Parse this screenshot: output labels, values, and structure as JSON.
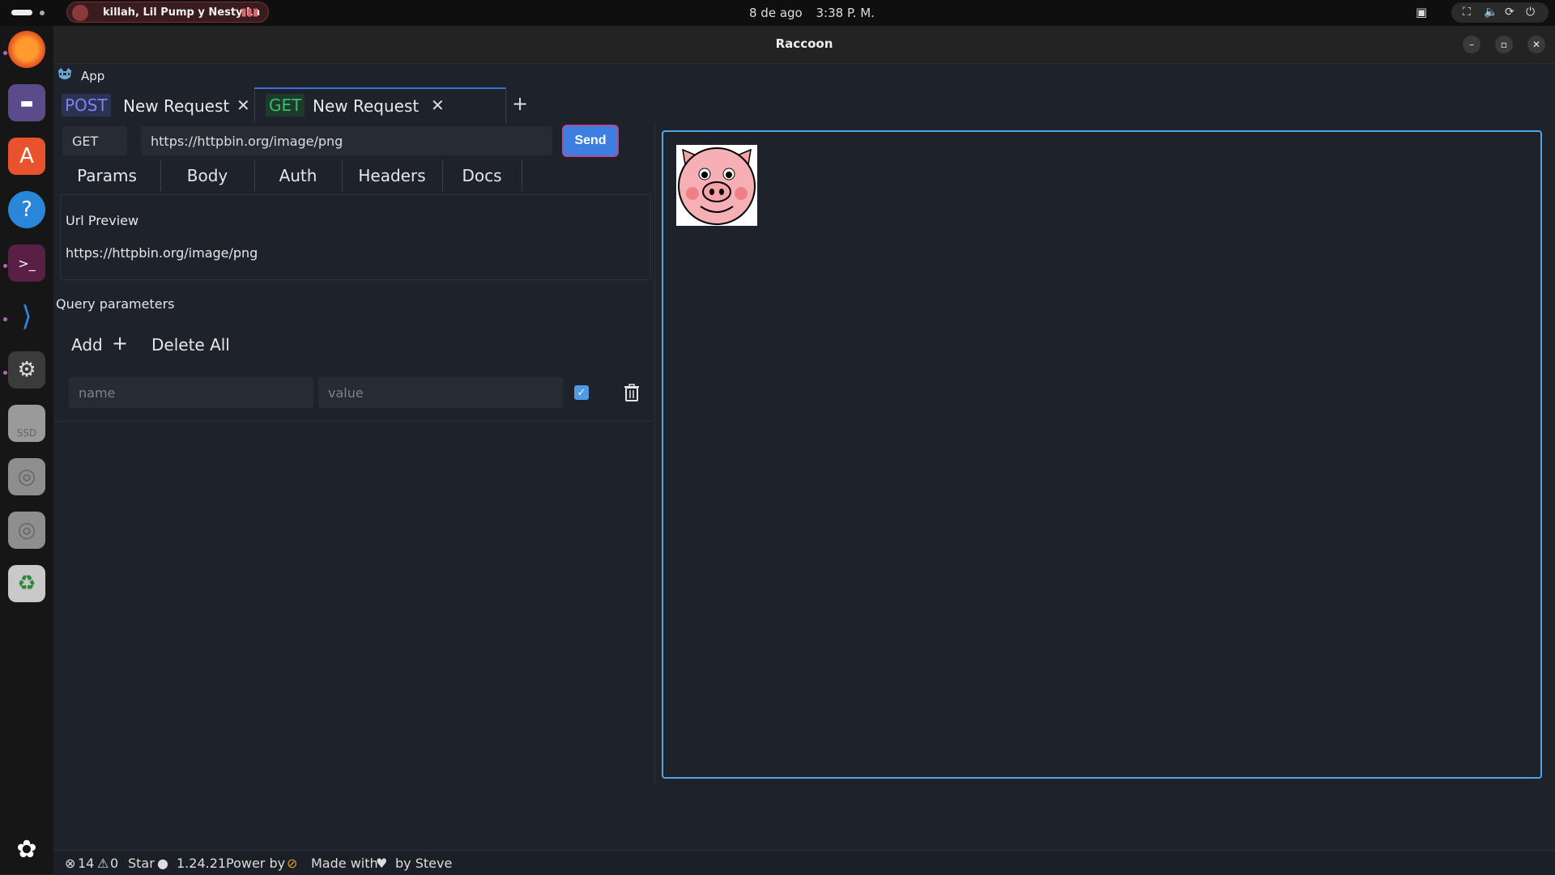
{
  "system": {
    "media_title": "killah, Lil Pump y Nesty La",
    "date": "8 de ago",
    "time": "3:38 P. M."
  },
  "window": {
    "title": "Raccoon",
    "menu_app": "App"
  },
  "tabs": [
    {
      "method": "POST",
      "name": "New Request",
      "method_color": "#8080ff"
    },
    {
      "method": "GET",
      "name": "New Request",
      "method_color": "#2fbf6a"
    }
  ],
  "request": {
    "method": "GET",
    "url": "https://httpbin.org/image/png",
    "send_label": "Send",
    "sub_tabs": [
      "Params",
      "Body",
      "Auth",
      "Headers",
      "Docs"
    ]
  },
  "params": {
    "url_preview_label": "Url Preview",
    "url_preview_value": "https://httpbin.org/image/png",
    "query_label": "Query parameters",
    "add_label": "Add",
    "delete_all_label": "Delete All",
    "name_placeholder": "name",
    "value_placeholder": "value",
    "enabled": true
  },
  "status": {
    "errors": "14",
    "warnings": "0",
    "star": "Star",
    "version": "1.24.21",
    "power_by": "Power by",
    "made_with": "Made with",
    "by": "by Steve"
  },
  "colors": {
    "accent": "#3c7fe0",
    "response_border": "#4ea7e8",
    "background": "#1e222a"
  }
}
